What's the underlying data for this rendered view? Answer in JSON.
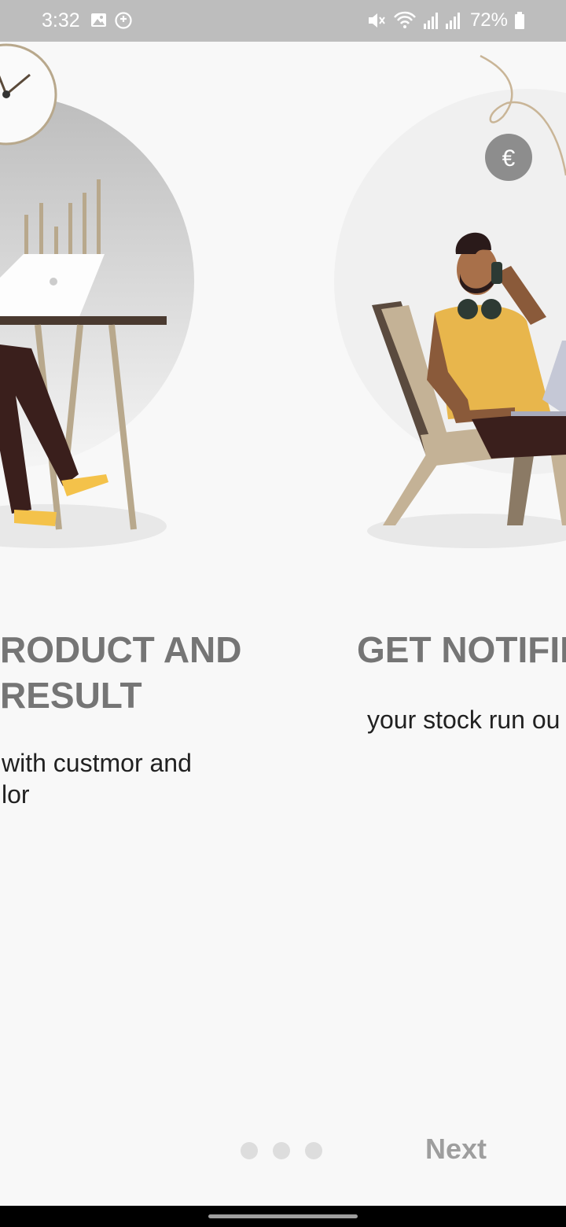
{
  "status_bar": {
    "time": "3:32",
    "icons": [
      "image-icon",
      "location-chat-icon",
      "mute-icon",
      "wifi-icon",
      "signal-icon",
      "signal-icon",
      "battery-icon"
    ],
    "battery_percent": "72%"
  },
  "onboarding": {
    "pages": [
      {
        "title": "RODUCT AND\nRESULT",
        "description": "with custmor and\nlor"
      },
      {
        "title": "GET NOTIFIE",
        "description": "your stock run ou"
      }
    ],
    "page_count": 3,
    "next_label": "Next"
  },
  "colors": {
    "status_bar": "#bdbdbd",
    "background": "#f8f8f8",
    "title": "#757575",
    "dot_inactive": "#dddddd",
    "next": "#9e9e9e"
  }
}
